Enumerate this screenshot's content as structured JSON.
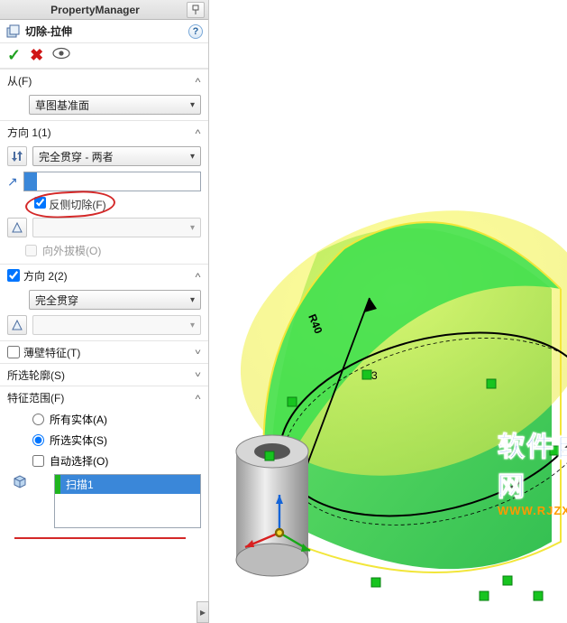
{
  "titlebar": {
    "title": "PropertyManager"
  },
  "feature": {
    "title": "切除-拉伸"
  },
  "sections": {
    "from": {
      "label": "从(F)",
      "value": "草图基准面"
    },
    "dir1": {
      "label": "方向 1(1)",
      "end_condition": "完全贯穿 - 两者",
      "distance": "",
      "flip_side": "反侧切除(F)",
      "draft_outward": "向外拔模(O)"
    },
    "dir2": {
      "label": "方向 2(2)",
      "end_condition": "完全贯穿"
    },
    "thin": {
      "label": "薄壁特征(T)"
    },
    "contours": {
      "label": "所选轮廓(S)"
    },
    "scope": {
      "label": "特征范围(F)",
      "opt_all": "所有实体(A)",
      "opt_selected": "所选实体(S)",
      "auto_select": "自动选择(O)",
      "selected_body": "扫描1"
    }
  },
  "viewport": {
    "dim_label": "R40",
    "marker": "3"
  },
  "watermark": {
    "line1": "软件自学网",
    "line2": "WWW.RJZXW.COM"
  }
}
